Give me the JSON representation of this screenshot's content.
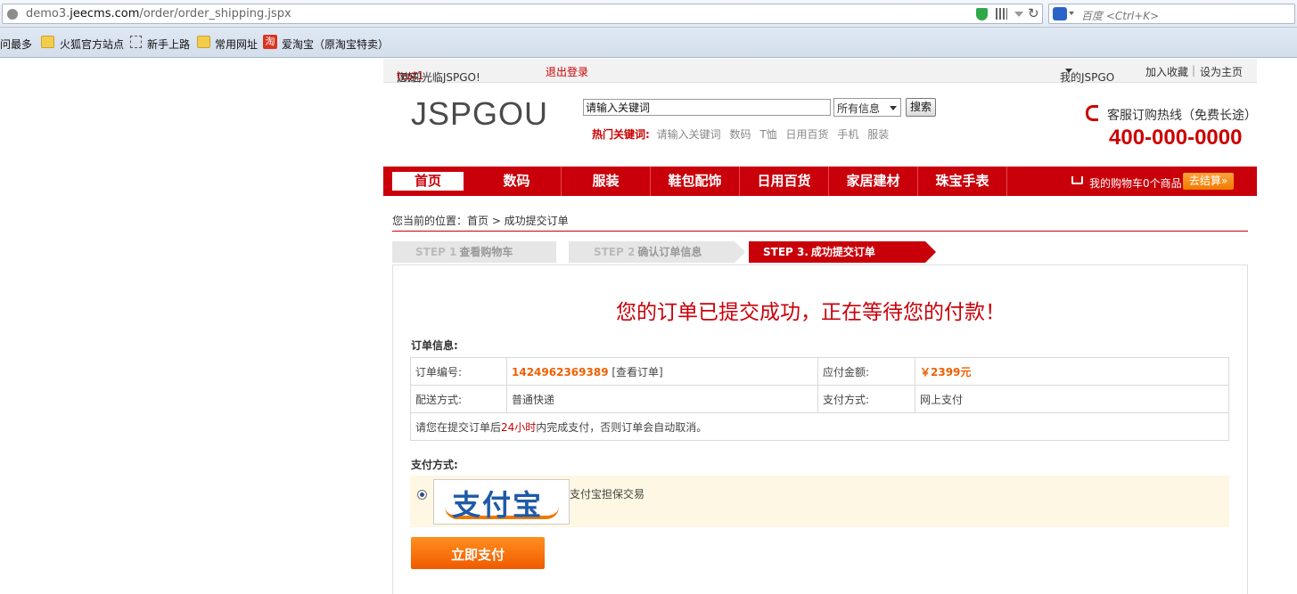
{
  "browser": {
    "url_prefix": "demo3.",
    "url_domain": "jeecms.com",
    "url_path": "/order/order_shipping.jspx",
    "search_placeholder": "百度 <Ctrl+K>",
    "bookmarks": [
      "访问最多",
      "火狐官方站点",
      "新手上路",
      "常用网址",
      "爱淘宝（原淘宝特卖）"
    ],
    "taobao_glyph": "淘"
  },
  "topbar": {
    "greeting_pre": "您好,",
    "username": "test1",
    "greeting_post": ",欢迎光临JSPGO!",
    "logout": "退出登录",
    "my_account": "我的JSPGO",
    "bookmark": "加入收藏",
    "divider": "|",
    "homepage": "设为主页"
  },
  "header": {
    "logo": "JSPGOU",
    "search_value": "请输入关键词",
    "select_value": "所有信息",
    "search_button": "搜索",
    "hot_label": "热门关键词:",
    "hot_keywords": [
      "请输入关键词",
      "数码",
      "T恤",
      "日用百货",
      "手机",
      "服装"
    ],
    "hotline_label": "客服订购热线（免费长途）",
    "hotline_number": "400-000-0000"
  },
  "nav": {
    "items": [
      "首页",
      "数码",
      "服装",
      "鞋包配饰",
      "日用百货",
      "家居建材",
      "珠宝手表"
    ],
    "cart_text": "我的购物车0个商品",
    "checkout": "去结算»"
  },
  "breadcrumb": "您当前的位置：首页 > 成功提交订单",
  "steps": [
    {
      "num": "STEP 1",
      "title": "查看购物车"
    },
    {
      "num": "STEP 2",
      "title": "确认订单信息"
    },
    {
      "num": "STEP 3.",
      "title": "成功提交订单"
    }
  ],
  "success_message": "您的订单已提交成功，正在等待您的付款！",
  "order": {
    "section_title": "订单信息:",
    "order_no_label": "订单编号:",
    "order_no": "1424962369389",
    "view_order": "[查看订单]",
    "amount_label": "应付金额:",
    "amount": "￥2399元",
    "shipping_label": "配送方式:",
    "shipping": "普通快递",
    "payment_label": "支付方式:",
    "payment": "网上支付",
    "note_pre": "请您在提交订单后",
    "note_hl": "24小时",
    "note_post": "内完成支付，否则订单会自动取消。"
  },
  "payment": {
    "section_title": "支付方式:",
    "logo_text": "支付宝",
    "option_label": "支付宝担保交易",
    "pay_button": "立即支付"
  }
}
